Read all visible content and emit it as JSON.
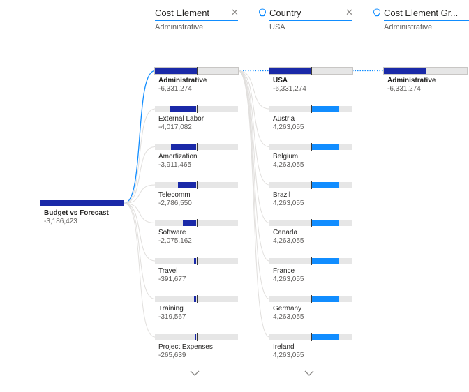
{
  "headers": [
    {
      "title": "Cost Element",
      "subtitle": "Administrative",
      "has_bulb": false,
      "has_close": true
    },
    {
      "title": "Country",
      "subtitle": "USA",
      "has_bulb": true,
      "has_close": true
    },
    {
      "title": "Cost Element Gr...",
      "subtitle": "Administrative",
      "has_bulb": true,
      "has_close": false
    }
  ],
  "root": {
    "label": "Budget vs Forecast",
    "value": "-3,186,423"
  },
  "cost_elements": [
    {
      "label": "Administrative",
      "value": "-6,331,274",
      "selected": true,
      "amount": -6331274
    },
    {
      "label": "External Labor",
      "value": "-4,017,082",
      "selected": false,
      "amount": -4017082
    },
    {
      "label": "Amortization",
      "value": "-3,911,465",
      "selected": false,
      "amount": -3911465
    },
    {
      "label": "Telecomm",
      "value": "-2,786,550",
      "selected": false,
      "amount": -2786550
    },
    {
      "label": "Software",
      "value": "-2,075,162",
      "selected": false,
      "amount": -2075162
    },
    {
      "label": "Travel",
      "value": "-391,677",
      "selected": false,
      "amount": -391677
    },
    {
      "label": "Training",
      "value": "-319,567",
      "selected": false,
      "amount": -319567
    },
    {
      "label": "Project Expenses",
      "value": "-265,639",
      "selected": false,
      "amount": -265639
    }
  ],
  "countries": [
    {
      "label": "USA",
      "value": "-6,331,274",
      "selected": true,
      "amount": -6331274
    },
    {
      "label": "Austria",
      "value": "4,263,055",
      "selected": false,
      "amount": 4263055
    },
    {
      "label": "Belgium",
      "value": "4,263,055",
      "selected": false,
      "amount": 4263055
    },
    {
      "label": "Brazil",
      "value": "4,263,055",
      "selected": false,
      "amount": 4263055
    },
    {
      "label": "Canada",
      "value": "4,263,055",
      "selected": false,
      "amount": 4263055
    },
    {
      "label": "France",
      "value": "4,263,055",
      "selected": false,
      "amount": 4263055
    },
    {
      "label": "Germany",
      "value": "4,263,055",
      "selected": false,
      "amount": 4263055
    },
    {
      "label": "Ireland",
      "value": "4,263,055",
      "selected": false,
      "amount": 4263055
    }
  ],
  "groups": [
    {
      "label": "Administrative",
      "value": "-6,331,274",
      "selected": true,
      "amount": -6331274
    }
  ],
  "max_abs": 6331274,
  "colors": {
    "negative": "#1A29A8",
    "positive": "#118DFF",
    "track": "#e6e6e6",
    "link": "#118DFF",
    "accent": "#118DFF"
  },
  "icons": {
    "close": "close-icon",
    "bulb": "lightbulb-icon",
    "expand": "chevron-down-icon"
  }
}
